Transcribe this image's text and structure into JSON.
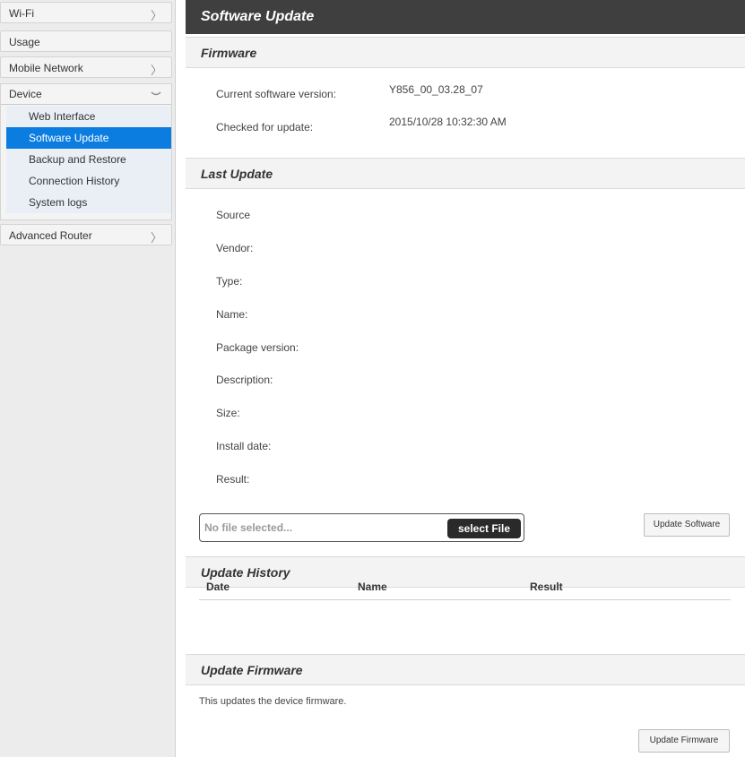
{
  "sidebar": {
    "wifi": "Wi-Fi",
    "usage": "Usage",
    "mobile_network": "Mobile Network",
    "device": "Device",
    "device_items": [
      {
        "label": "Web Interface"
      },
      {
        "label": "Software Update",
        "active": true
      },
      {
        "label": "Backup and Restore"
      },
      {
        "label": "Connection History"
      },
      {
        "label": "System logs"
      }
    ],
    "advanced_router": "Advanced Router"
  },
  "page": {
    "title": "Software Update"
  },
  "firmware": {
    "title": "Firmware",
    "current_version_label": "Current software version:",
    "current_version_value": "Y856_00_03.28_07",
    "checked_label": "Checked for update:",
    "checked_value": "2015/10/28 10:32:30 AM"
  },
  "last_update": {
    "title": "Last Update",
    "fields": [
      "Source",
      "Vendor:",
      "Type:",
      "Name:",
      "Package version:",
      "Description:",
      "Size:",
      "Install date:",
      "Result:"
    ],
    "file_placeholder": "No file selected...",
    "select_file_label": "select File",
    "update_software_label": "Update Software"
  },
  "update_history": {
    "title": "Update History",
    "columns": [
      "Date",
      "Name",
      "Result"
    ]
  },
  "update_firmware": {
    "title": "Update Firmware",
    "description": "This updates the device firmware.",
    "button_label": "Update Firmware"
  },
  "colors": {
    "active_nav": "#0b7de0",
    "header_bg": "#3f3f3f"
  }
}
